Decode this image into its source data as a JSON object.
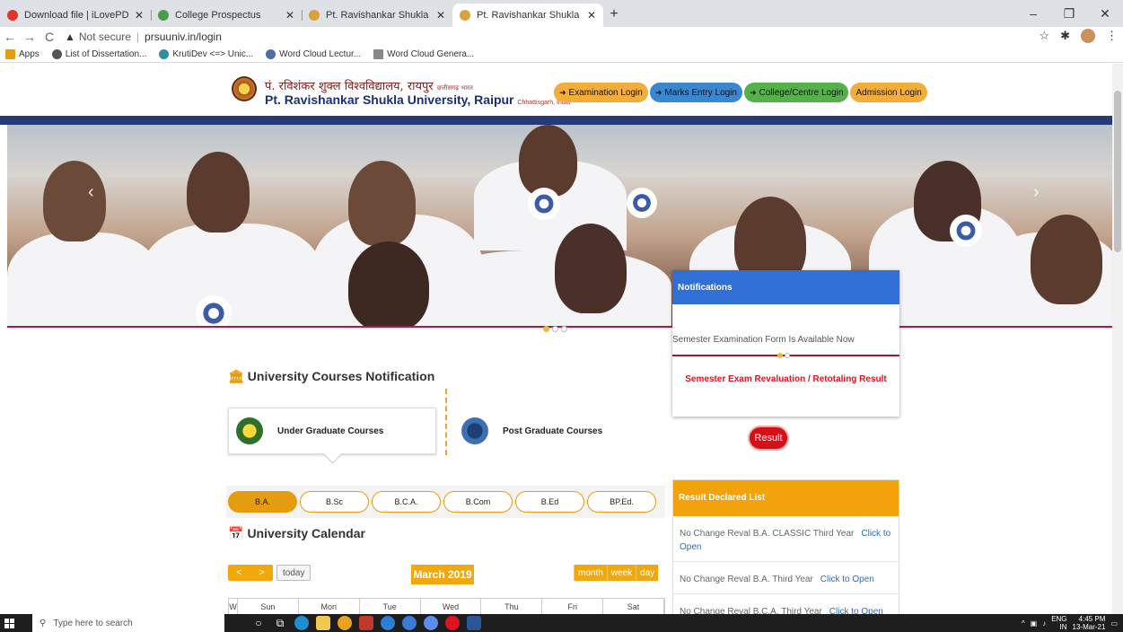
{
  "browser": {
    "tabs": [
      {
        "title": "Download file | iLovePDF",
        "color": "#e5322d",
        "active": false
      },
      {
        "title": "College Prospectus",
        "color": "#4a9c4c",
        "active": false
      },
      {
        "title": "Pt. Ravishankar Shukla University",
        "color": "#d8a33b",
        "active": false
      },
      {
        "title": "Pt. Ravishankar Shukla Universit",
        "color": "#d8a33b",
        "active": true
      }
    ],
    "new_tab": "+",
    "window_controls": [
      "–",
      "❐",
      "✕"
    ],
    "nav": {
      "back": "←",
      "forward": "→",
      "reload": "C"
    },
    "address": {
      "warning": "▲",
      "security": "Not secure",
      "separator": "|",
      "url": "prsuuniv.in/login"
    },
    "toolbar_icons": [
      "☆",
      "✱"
    ],
    "bookmarks": [
      {
        "label": "Apps",
        "color": "#e59c0e"
      },
      {
        "label": "List of Dissertation...",
        "color": "#555"
      },
      {
        "label": "KrutiDev <=> Unic...",
        "color": "#2a8f9e"
      },
      {
        "label": "Word Cloud Lectur...",
        "color": "#4a6fa5"
      },
      {
        "label": "Word Cloud Genera...",
        "color": "#888"
      }
    ]
  },
  "site": {
    "title_hindi": "पं. रविशंकर शुक्ल विश्वविद्यालय, रायपुर",
    "title_hindi_small": "छत्तीसगढ़ भारत",
    "title_english": "Pt. Ravishankar Shukla University, Raipur",
    "title_english_small": "Chhattisgarh, India",
    "login_buttons": [
      {
        "label": "Examination Login",
        "icon": "➜",
        "color": "#f2ad3b"
      },
      {
        "label": "Marks Entry Login",
        "icon": "➜",
        "color": "#3a86d1"
      },
      {
        "label": "College/Centre Login",
        "icon": "➜",
        "color": "#55b24a"
      },
      {
        "label": "Admission Login",
        "icon": "",
        "color": "#f2ad3b"
      }
    ],
    "slider": {
      "prev": "‹",
      "next": "›"
    }
  },
  "notifications": {
    "heading": "Notifications",
    "item": "Semester Examination Form Is Available Now",
    "link": "Semester Exam Revaluation / Retotaling Result",
    "result_button": "Result"
  },
  "courses": {
    "title": "University Courses Notification",
    "ug": "Under Graduate Courses",
    "pg": "Post Graduate Courses",
    "pills": [
      "B.A.",
      "B.Sc",
      "B.C.A.",
      "B.Com",
      "B.Ed",
      "BP.Ed."
    ]
  },
  "calendar": {
    "title": "University Calendar",
    "prev": "<",
    "next": ">",
    "today": "today",
    "month_label": "March 2019",
    "views": [
      "month",
      "week",
      "day"
    ],
    "headers": [
      "W",
      "Sun",
      "Mon",
      "Tue",
      "Wed",
      "Thu",
      "Fri",
      "Sat"
    ]
  },
  "results": {
    "heading": "Result Declared List",
    "items": [
      {
        "text": "No Change Reval B.A. CLASSIC Third Year",
        "link": "Click to Open"
      },
      {
        "text": "No Change Reval B.A. Third Year",
        "link": "Click to Open"
      },
      {
        "text": "No Change Reval B.C.A. Third Year",
        "link": "Click to Open"
      }
    ]
  },
  "taskbar": {
    "search_placeholder": "Type here to search",
    "lang": "ENG",
    "region": "IN",
    "time": "4:45 PM",
    "date": "13-Mar-21"
  }
}
